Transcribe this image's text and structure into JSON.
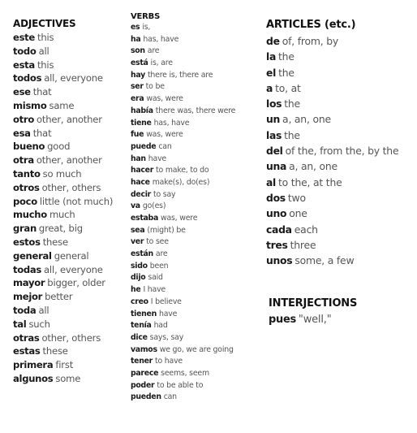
{
  "adjectives": {
    "heading": "ADJECTIVES",
    "items": [
      {
        "es": "este",
        "en": "this"
      },
      {
        "es": "todo",
        "en": "all"
      },
      {
        "es": "esta",
        "en": "this"
      },
      {
        "es": "todos",
        "en": "all, everyone"
      },
      {
        "es": "ese",
        "en": "that"
      },
      {
        "es": "mismo",
        "en": "same"
      },
      {
        "es": "otro",
        "en": "other, another"
      },
      {
        "es": "esa",
        "en": "that"
      },
      {
        "es": "bueno",
        "en": "good"
      },
      {
        "es": "otra",
        "en": "other, another"
      },
      {
        "es": "tanto",
        "en": "so much"
      },
      {
        "es": "otros",
        "en": "other, others"
      },
      {
        "es": "poco",
        "en": "little (not much)"
      },
      {
        "es": "mucho",
        "en": "much"
      },
      {
        "es": "gran",
        "en": "great, big"
      },
      {
        "es": "estos",
        "en": "these"
      },
      {
        "es": "general",
        "en": "general"
      },
      {
        "es": "todas",
        "en": "all, everyone"
      },
      {
        "es": "mayor",
        "en": "bigger, older"
      },
      {
        "es": "mejor",
        "en": "better"
      },
      {
        "es": "toda",
        "en": "all"
      },
      {
        "es": "tal",
        "en": "such"
      },
      {
        "es": "otras",
        "en": "other, others"
      },
      {
        "es": "estas",
        "en": "these"
      },
      {
        "es": "primera",
        "en": "first"
      },
      {
        "es": "algunos",
        "en": "some"
      }
    ]
  },
  "verbs": {
    "heading": "VERBS",
    "items": [
      {
        "es": "es",
        "en": "is,"
      },
      {
        "es": "ha",
        "en": "has, have"
      },
      {
        "es": "son",
        "en": "are"
      },
      {
        "es": "está",
        "en": "is, are"
      },
      {
        "es": "hay",
        "en": "there is, there are"
      },
      {
        "es": "ser",
        "en": "to be"
      },
      {
        "es": "era",
        "en": "was, were"
      },
      {
        "es": "había",
        "en": "there was, there were"
      },
      {
        "es": "tiene",
        "en": "has, have"
      },
      {
        "es": "fue",
        "en": "was, were"
      },
      {
        "es": "puede",
        "en": "can"
      },
      {
        "es": "han",
        "en": "have"
      },
      {
        "es": "hacer",
        "en": "to make, to do"
      },
      {
        "es": "hace",
        "en": "make(s), do(es)"
      },
      {
        "es": "decir",
        "en": "to say"
      },
      {
        "es": "va",
        "en": "go(es)"
      },
      {
        "es": "estaba",
        "en": "was, were"
      },
      {
        "es": "sea",
        "en": "(might) be"
      },
      {
        "es": "ver",
        "en": "to see"
      },
      {
        "es": "están",
        "en": "are"
      },
      {
        "es": "sido",
        "en": "been"
      },
      {
        "es": "dijo",
        "en": "said"
      },
      {
        "es": "he",
        "en": "I have"
      },
      {
        "es": "creo",
        "en": "I believe"
      },
      {
        "es": "tienen",
        "en": "have"
      },
      {
        "es": "tenía",
        "en": "had"
      },
      {
        "es": "dice",
        "en": "says, say"
      },
      {
        "es": "vamos",
        "en": "we go, we are going"
      },
      {
        "es": "tener",
        "en": "to have"
      },
      {
        "es": "parece",
        "en": "seems,  seem"
      },
      {
        "es": "poder",
        "en": "to be able to"
      },
      {
        "es": "pueden",
        "en": "can"
      }
    ]
  },
  "articles": {
    "heading": "ARTICLES (etc.)",
    "items": [
      {
        "es": "de",
        "en": "of, from, by"
      },
      {
        "es": "la",
        "en": "the"
      },
      {
        "es": "el",
        "en": "the"
      },
      {
        "es": "a",
        "en": "to, at"
      },
      {
        "es": "los",
        "en": "the"
      },
      {
        "es": "un",
        "en": "a, an, one"
      },
      {
        "es": "las",
        "en": "the"
      },
      {
        "es": "del",
        "en": "of the, from the, by the"
      },
      {
        "es": "una",
        "en": "a, an, one"
      },
      {
        "es": "al",
        "en": "to the, at the"
      },
      {
        "es": "dos",
        "en": "two"
      },
      {
        "es": "uno",
        "en": "one"
      },
      {
        "es": "cada",
        "en": "each"
      },
      {
        "es": "tres",
        "en": "three"
      },
      {
        "es": "unos",
        "en": "some, a few"
      }
    ]
  },
  "interjections": {
    "heading": "INTERJECTIONS",
    "items": [
      {
        "es": "pues",
        "en": "\"well,\""
      }
    ]
  }
}
